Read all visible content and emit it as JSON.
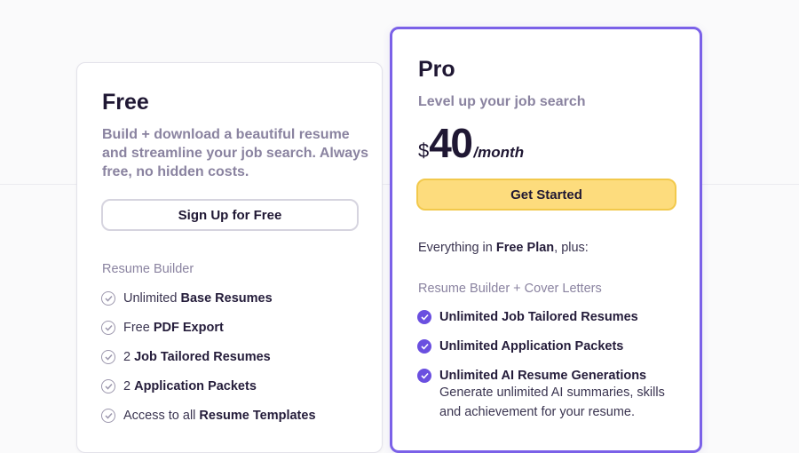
{
  "free": {
    "title": "Free",
    "description": "Build + download a beautiful resume and streamline your job search. Always free, no hidden costs.",
    "button": "Sign Up for Free",
    "section": "Resume Builder",
    "features": [
      {
        "pre": "Unlimited ",
        "bold": "Base Resumes"
      },
      {
        "pre": "Free ",
        "bold": "PDF Export"
      },
      {
        "pre": "2 ",
        "bold": "Job Tailored Resumes"
      },
      {
        "pre": "2 ",
        "bold": "Application Packets"
      },
      {
        "pre": "Access to all ",
        "bold": "Resume Templates"
      }
    ]
  },
  "pro": {
    "title": "Pro",
    "subtitle": "Level up your job search",
    "price": {
      "currency": "$",
      "amount": "40",
      "period": "/month"
    },
    "button": "Get Started",
    "plus_line": {
      "pre": "Everything in ",
      "bold": "Free Plan",
      "post": ", plus:"
    },
    "section": "Resume Builder + Cover Letters",
    "features": [
      {
        "label": "Unlimited Job Tailored Resumes"
      },
      {
        "label": "Unlimited Application Packets"
      },
      {
        "label": "Unlimited AI Resume Generations",
        "description": "Generate unlimited AI summaries, skills and achievement for your resume."
      }
    ]
  },
  "colors": {
    "accent": "#7b61e8",
    "check_fill": "#6a4fe0",
    "cta": "#fddc7d",
    "cta_border": "#f2c94c",
    "muted_text": "#8a83a0"
  },
  "icons": {
    "free_check": "check-circle-outline-icon",
    "pro_check": "check-circle-filled-icon"
  }
}
